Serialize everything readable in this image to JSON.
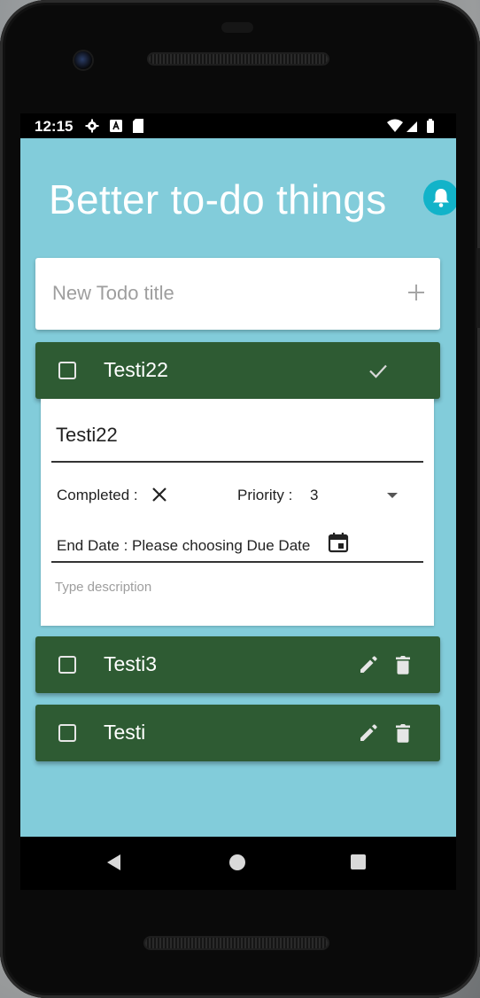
{
  "status_bar": {
    "time": "12:15",
    "icons": [
      "gear-icon",
      "a-badge-icon",
      "sd-card-icon"
    ],
    "right_icons": [
      "wifi-icon",
      "signal-icon",
      "battery-icon"
    ]
  },
  "app": {
    "title": "Better to-do things",
    "notification_icon": "bell-icon"
  },
  "new_todo": {
    "placeholder": "New Todo title",
    "add_icon": "plus-icon"
  },
  "todos": [
    {
      "title": "Testi22",
      "checked": false,
      "expanded": true,
      "actions": [
        "check-icon"
      ]
    },
    {
      "title": "Testi3",
      "checked": false,
      "expanded": false,
      "actions": [
        "pencil-icon",
        "trash-icon"
      ]
    },
    {
      "title": "Testi",
      "checked": false,
      "expanded": false,
      "actions": [
        "pencil-icon",
        "trash-icon"
      ]
    }
  ],
  "detail": {
    "title_value": "Testi22",
    "completed_label": "Completed :",
    "priority_label": "Priority :",
    "priority_value": "3",
    "end_date_label": "End Date : Please choosing Due Date",
    "description_placeholder": "Type description"
  },
  "colors": {
    "screen_bg": "#82ccda",
    "todo_bar": "#2e5b33",
    "bell_button": "#12b3c9"
  }
}
